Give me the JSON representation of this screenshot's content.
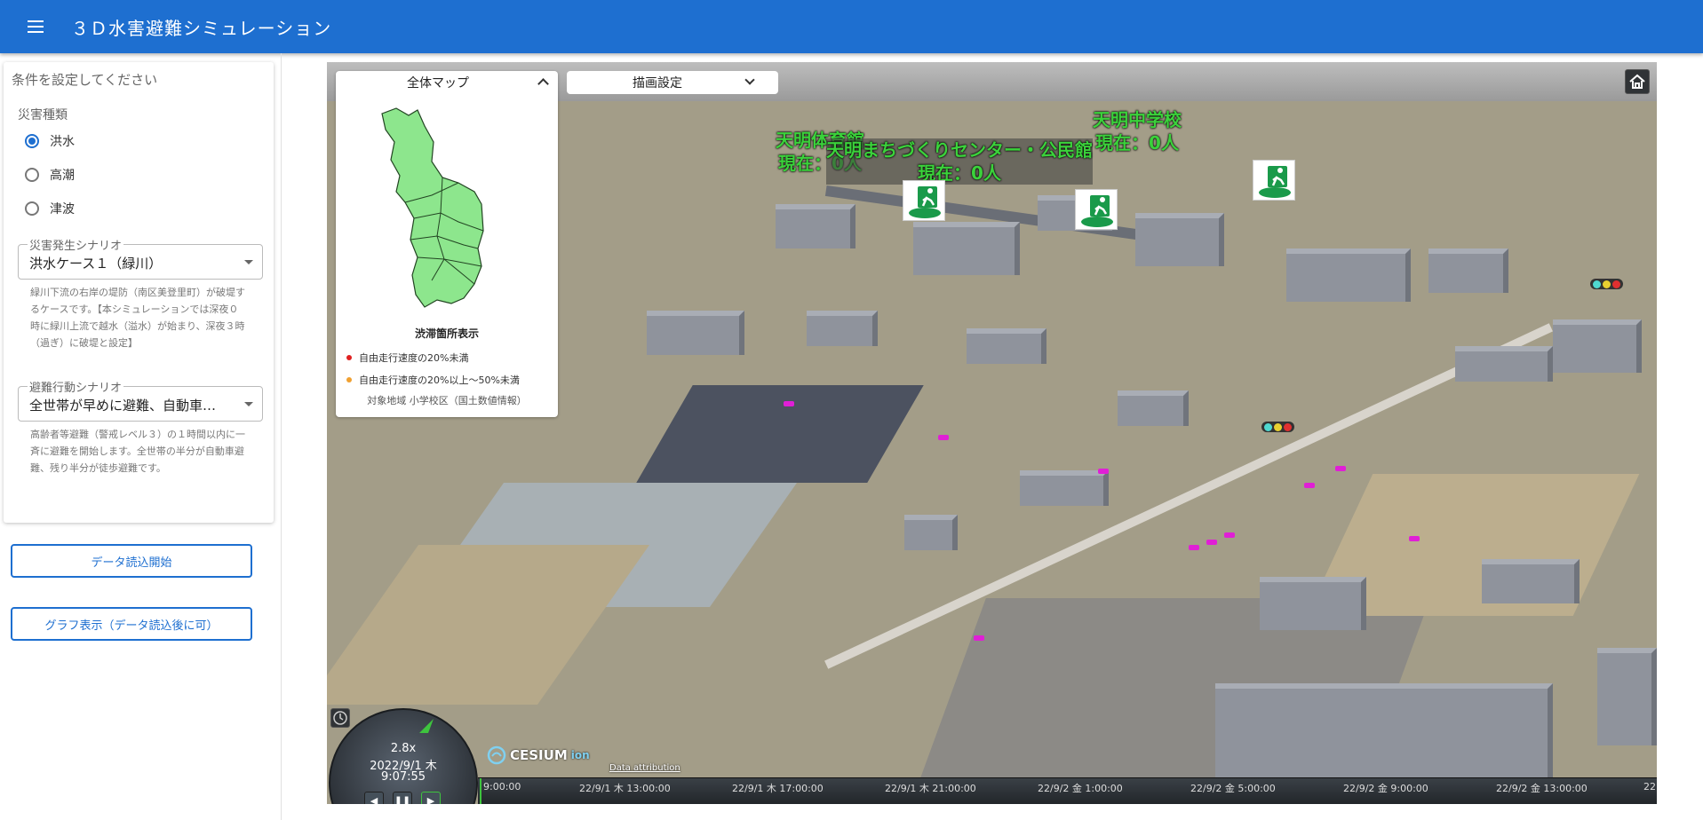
{
  "app": {
    "title": "３Ｄ水害避難シミュレーション"
  },
  "panel": {
    "title": "条件を設定してください",
    "disaster_type_label": "災害種類",
    "disaster_types": [
      {
        "label": "洪水",
        "selected": true
      },
      {
        "label": "高潮",
        "selected": false
      },
      {
        "label": "津波",
        "selected": false
      }
    ],
    "scenario": {
      "label": "災害発生シナリオ",
      "value": "洪水ケース１（緑川）",
      "description": "緑川下流の右岸の堤防（南区美登里町）が破堤するケースです。【本シミュレーションでは深夜０時に緑川上流で越水（溢水）が始まり、深夜３時（過ぎ）に破堤と設定】"
    },
    "evacuation": {
      "label": "避難行動シナリオ",
      "value": "全世帯が早めに避難、自動車避難と徒歩避難",
      "description": "高齢者等避難（警戒レベル３）の１時間以内に一斉に避難を開始します。全世帯の半分が自動車避難、残り半分が徒歩避難です。"
    }
  },
  "buttons": {
    "load_data": "データ読込開始",
    "show_graph": "グラフ表示（データ読込後に可）"
  },
  "minimap": {
    "title": "全体マップ",
    "legend_title": "渋滞箇所表示",
    "legend": [
      {
        "label": "自由走行速度の20%未満",
        "color": "#e02020"
      },
      {
        "label": "自由走行速度の20%以上～50%未満",
        "color": "#f0a030"
      }
    ],
    "note": "対象地域 小学校区（国土数値情報）"
  },
  "draw_settings": {
    "label": "描画設定"
  },
  "shelters": [
    {
      "name": "天明体育館",
      "current": "現在：0人"
    },
    {
      "name": "天明まちづくりセンター・公民館",
      "current": "現在：0人"
    },
    {
      "name": "天明中学校",
      "current": "現在：0人"
    }
  ],
  "clock": {
    "speed": "2.8x",
    "date": "2022/9/1 木",
    "time": "9:07:55"
  },
  "timeline": {
    "ticks": [
      "9:00:00",
      "22/9/1 木 13:00:00",
      "22/9/1 木 17:00:00",
      "22/9/1 木 21:00:00",
      "22/9/2 金 1:00:00",
      "22/9/2 金 5:00:00",
      "22/9/2 金 9:00:00",
      "22/9/2 金 13:00:00",
      "22"
    ]
  },
  "cesium": {
    "logo": "CESIUM",
    "ion": "ion",
    "attribution": "Data attribution"
  },
  "colors": {
    "appbar": "#1e6fd0",
    "label_green": "#3bd23b",
    "shelter_green": "#1a9a4a"
  }
}
